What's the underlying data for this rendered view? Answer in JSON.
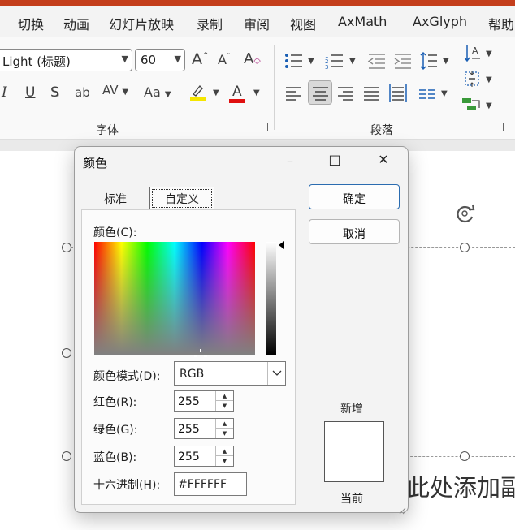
{
  "menu": {
    "items": [
      "切换",
      "动画",
      "幻灯片放映",
      "录制",
      "审阅",
      "视图",
      "AxMath",
      "AxGlyph",
      "帮助"
    ]
  },
  "ribbon": {
    "font_name": "Light (标题)",
    "font_size": "60",
    "groups": {
      "font": "字体",
      "paragraph": "段落"
    },
    "icons": {
      "grow_font": "A",
      "shrink_font": "A",
      "clear_format": "A",
      "italic": "I",
      "underline": "U",
      "shadow": "S",
      "strikethrough": "ab",
      "char_spacing": "AV",
      "change_case": "Aa",
      "font_color": "A"
    },
    "colors": {
      "highlight": "#f5e600",
      "font_color": "#e01010",
      "accent": "#1a5fb4"
    }
  },
  "slide": {
    "placeholder_text": "此处添加副"
  },
  "dialog": {
    "title": "颜色",
    "tabs": [
      "标准",
      "自定义"
    ],
    "active_tab": "自定义",
    "color_label": "颜色(C):",
    "color_label_key": "C",
    "mode_label": "颜色模式(D):",
    "mode_value": "RGB",
    "red_label": "红色(R):",
    "green_label": "绿色(G):",
    "blue_label": "蓝色(B):",
    "hex_label": "十六进制(H):",
    "red": "255",
    "green": "255",
    "blue": "255",
    "hex": "#FFFFFF",
    "ok": "确定",
    "cancel": "取消",
    "new_label": "新增",
    "current_label": "当前",
    "new_color": "#FFFFFF",
    "current_color": "#FFFFFF"
  }
}
